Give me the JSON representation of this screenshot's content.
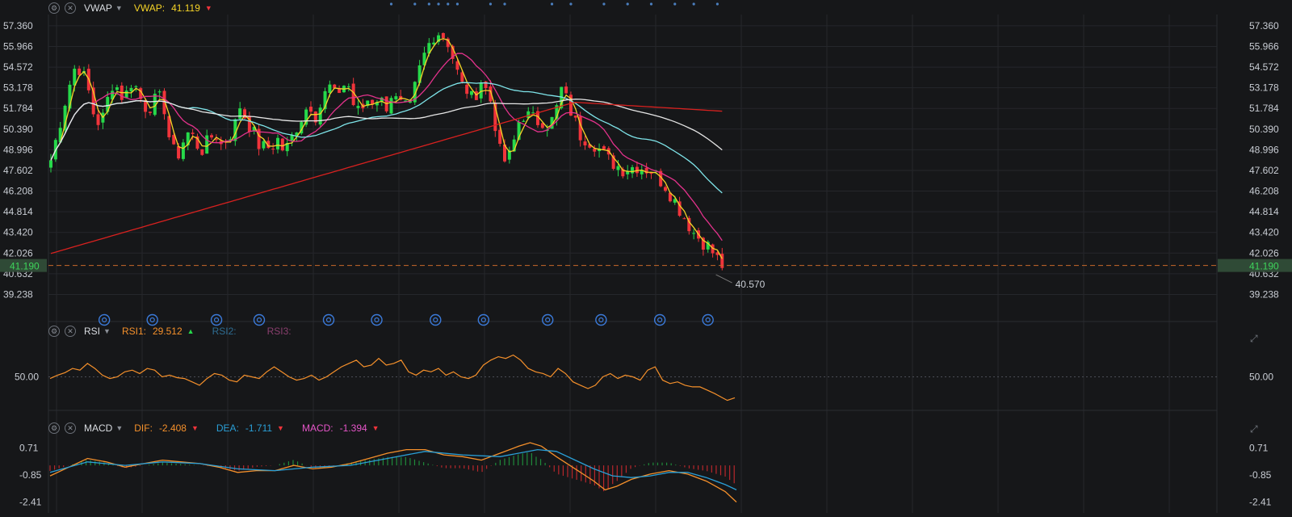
{
  "colors": {
    "background": "#161719",
    "grid": "#25272b",
    "axis_text": "#c9cdd4",
    "bull": "#26d94a",
    "bear": "#f0343b",
    "ma_yellow": "#f5d327",
    "ma_magenta": "#e3328c",
    "ma_cyan": "#7fe5ea",
    "ma_white": "#e6e6e6",
    "ma_red": "#d8211f",
    "rsi": "#f5902b",
    "dif": "#f5902b",
    "dea": "#2a9fd6",
    "price_line": "#c8692a",
    "last_price_bg": "#2f4a36",
    "last_price_text": "#3ed45b"
  },
  "main_pane": {
    "indicator_name": "VWAP",
    "indicator_label": "VWAP:",
    "indicator_value": "41.119",
    "indicator_value_color": "#f5d327",
    "settings_icon": "gear-icon",
    "close_icon": "close-icon"
  },
  "rsi_pane": {
    "indicator_name": "RSI",
    "rsi1_label": "RSI1:",
    "rsi1_value": "29.512",
    "rsi2_label": "RSI2:",
    "rsi3_label": "RSI3:"
  },
  "macd_pane": {
    "indicator_name": "MACD",
    "dif_label": "DIF:",
    "dif_value": "-2.408",
    "dea_label": "DEA:",
    "dea_value": "-1.711",
    "macd_label": "MACD:",
    "macd_value": "-1.394"
  },
  "chart_data": [
    {
      "type": "candlestick",
      "title": "",
      "y_ticks": [
        "57.360",
        "55.966",
        "54.572",
        "53.178",
        "51.784",
        "50.390",
        "48.996",
        "47.602",
        "46.208",
        "44.814",
        "43.420",
        "42.026",
        "40.632",
        "39.238"
      ],
      "ylim": [
        38.5,
        57.9
      ],
      "last_price": "41.190",
      "last_price_value": 41.19,
      "low_annotation": "40.570",
      "low_value": 40.57,
      "x_range": [
        0,
        245
      ],
      "last_index": 142,
      "low_index": 140,
      "close_anchors": [
        [
          0,
          48.3
        ],
        [
          4,
          50.6
        ],
        [
          8,
          53.0
        ],
        [
          12,
          54.8
        ],
        [
          15,
          54.2
        ],
        [
          18,
          52.9
        ],
        [
          21,
          51.0
        ],
        [
          24,
          50.8
        ],
        [
          27,
          52.4
        ],
        [
          30,
          53.8
        ],
        [
          33,
          52.6
        ],
        [
          36,
          52.8
        ],
        [
          39,
          53.8
        ],
        [
          42,
          52.6
        ],
        [
          45,
          51.9
        ],
        [
          48,
          52.0
        ],
        [
          51,
          52.6
        ],
        [
          54,
          51.8
        ],
        [
          57,
          49.2
        ],
        [
          60,
          48.5
        ],
        [
          63,
          49.6
        ],
        [
          66,
          50.3
        ],
        [
          69,
          49.4
        ],
        [
          72,
          49.0
        ],
        [
          75,
          49.6
        ],
        [
          78,
          50.2
        ],
        [
          81,
          49.3
        ],
        [
          84,
          49.8
        ],
        [
          87,
          50.4
        ],
        [
          90,
          52.0
        ],
        [
          93,
          51.0
        ],
        [
          96,
          50.3
        ],
        [
          99,
          49.3
        ],
        [
          102,
          49.1
        ],
        [
          105,
          49.2
        ],
        [
          108,
          49.7
        ],
        [
          111,
          48.8
        ],
        [
          114,
          49.6
        ],
        [
          117,
          50.6
        ],
        [
          120,
          51.4
        ],
        [
          123,
          52.2
        ],
        [
          126,
          51.3
        ],
        [
          129,
          52.2
        ],
        [
          132,
          53.4
        ],
        [
          135,
          52.6
        ],
        [
          138,
          53.2
        ],
        [
          141,
          53.6
        ],
        [
          144,
          52.0
        ],
        [
          147,
          51.4
        ],
        [
          150,
          52.4
        ],
        [
          153,
          52.3
        ],
        [
          156,
          52.6
        ],
        [
          159,
          51.8
        ],
        [
          162,
          52.8
        ],
        [
          165,
          52.1
        ],
        [
          168,
          51.8
        ],
        [
          171,
          51.8
        ],
        [
          174,
          53.8
        ],
        [
          177,
          55.2
        ],
        [
          180,
          56.2
        ],
        [
          183,
          57.0
        ],
        [
          186,
          56.8
        ],
        [
          189,
          56.2
        ],
        [
          192,
          54.8
        ],
        [
          195,
          53.4
        ],
        [
          198,
          53.0
        ],
        [
          201,
          52.2
        ],
        [
          204,
          53.8
        ],
        [
          207,
          53.0
        ],
        [
          210,
          52.0
        ],
        [
          213,
          49.0
        ],
        [
          216,
          48.2
        ],
        [
          219,
          48.7
        ],
        [
          222,
          50.8
        ],
        [
          225,
          51.4
        ],
        [
          228,
          51.2
        ],
        [
          231,
          50.9
        ],
        [
          234,
          51.0
        ],
        [
          237,
          50.6
        ],
        [
          240,
          51.5
        ],
        [
          243,
          53.2
        ],
        [
          245,
          52.4
        ]
      ],
      "close_anchors_tail": [
        [
          0,
          52.4
        ],
        [
          3,
          50.0
        ],
        [
          6,
          49.4
        ],
        [
          9,
          48.3
        ],
        [
          12,
          47.7
        ],
        [
          15,
          47.9
        ],
        [
          18,
          47.6
        ],
        [
          21,
          46.6
        ],
        [
          24,
          45.0
        ],
        [
          27,
          43.4
        ],
        [
          30,
          42.5
        ],
        [
          33,
          41.2
        ]
      ],
      "tail_start_index": 109,
      "ma_note": "",
      "series": [
        {
          "color_key": "ma_yellow",
          "period": 3
        },
        {
          "color_key": "ma_magenta",
          "period": 10
        },
        {
          "color_key": "ma_cyan",
          "period": 30
        },
        {
          "color_key": "ma_white",
          "period": 60
        },
        {
          "color_key": "ma_red",
          "period": 160
        }
      ],
      "event_marker_indices": [
        10,
        19,
        31,
        39,
        52,
        61,
        72,
        81,
        93,
        103,
        114,
        123
      ],
      "top_dot_indices": [
        72,
        77,
        80,
        82,
        84,
        86,
        93,
        96,
        106,
        110,
        117,
        122,
        127,
        132,
        136,
        141
      ]
    },
    {
      "type": "line",
      "title": "",
      "y_tick": "50.00",
      "ylim": [
        10,
        90
      ],
      "reference_value": 50,
      "series": [
        {
          "color_key": "rsi",
          "points": [
            [
              0,
              48
            ],
            [
              3,
              52
            ],
            [
              6,
              55
            ],
            [
              9,
              60
            ],
            [
              12,
              58
            ],
            [
              15,
              66
            ],
            [
              18,
              60
            ],
            [
              21,
              52
            ],
            [
              24,
              48
            ],
            [
              27,
              50
            ],
            [
              30,
              56
            ],
            [
              33,
              58
            ],
            [
              36,
              54
            ],
            [
              39,
              60
            ],
            [
              42,
              58
            ],
            [
              45,
              50
            ],
            [
              48,
              52
            ],
            [
              51,
              49
            ],
            [
              54,
              48
            ],
            [
              57,
              44
            ],
            [
              60,
              40
            ],
            [
              63,
              48
            ],
            [
              66,
              54
            ],
            [
              69,
              52
            ],
            [
              72,
              46
            ],
            [
              75,
              44
            ],
            [
              78,
              52
            ],
            [
              81,
              50
            ],
            [
              84,
              48
            ],
            [
              87,
              56
            ],
            [
              90,
              62
            ],
            [
              93,
              56
            ],
            [
              96,
              50
            ],
            [
              99,
              46
            ],
            [
              102,
              48
            ],
            [
              105,
              52
            ],
            [
              108,
              46
            ],
            [
              111,
              50
            ],
            [
              114,
              56
            ],
            [
              117,
              62
            ],
            [
              120,
              66
            ],
            [
              123,
              70
            ],
            [
              126,
              62
            ],
            [
              129,
              64
            ],
            [
              132,
              72
            ],
            [
              135,
              64
            ],
            [
              138,
              66
            ],
            [
              141,
              70
            ],
            [
              144,
              56
            ],
            [
              147,
              52
            ],
            [
              150,
              58
            ],
            [
              153,
              56
            ],
            [
              156,
              60
            ],
            [
              159,
              52
            ],
            [
              162,
              56
            ],
            [
              165,
              50
            ],
            [
              168,
              48
            ],
            [
              171,
              52
            ],
            [
              174,
              64
            ],
            [
              177,
              70
            ],
            [
              180,
              74
            ],
            [
              183,
              72
            ],
            [
              186,
              76
            ],
            [
              189,
              70
            ],
            [
              192,
              60
            ],
            [
              195,
              56
            ],
            [
              198,
              54
            ],
            [
              201,
              50
            ],
            [
              204,
              60
            ],
            [
              207,
              54
            ],
            [
              210,
              44
            ],
            [
              213,
              40
            ],
            [
              216,
              36
            ],
            [
              219,
              40
            ],
            [
              222,
              50
            ],
            [
              225,
              54
            ],
            [
              228,
              48
            ],
            [
              231,
              52
            ],
            [
              234,
              50
            ],
            [
              237,
              46
            ],
            [
              240,
              58
            ],
            [
              243,
              62
            ],
            [
              246,
              46
            ],
            [
              249,
              42
            ],
            [
              252,
              44
            ],
            [
              255,
              40
            ],
            [
              258,
              38
            ],
            [
              261,
              38
            ],
            [
              264,
              34
            ],
            [
              267,
              30
            ],
            [
              270,
              25
            ],
            [
              272,
              22
            ],
            [
              275,
              25
            ]
          ]
        }
      ]
    },
    {
      "type": "line",
      "title": "",
      "y_ticks": [
        "0.71",
        "-0.85",
        "-2.41"
      ],
      "ylim": [
        -2.7,
        1.0
      ],
      "series": [
        {
          "name": "DIF",
          "color_key": "dif",
          "points": [
            [
              0,
              -0.9
            ],
            [
              10,
              -0.4
            ],
            [
              20,
              0.1
            ],
            [
              30,
              -0.1
            ],
            [
              40,
              -0.4
            ],
            [
              50,
              -0.2
            ],
            [
              60,
              0.0
            ],
            [
              70,
              -0.1
            ],
            [
              80,
              -0.2
            ],
            [
              90,
              -0.4
            ],
            [
              100,
              -0.7
            ],
            [
              110,
              -0.6
            ],
            [
              120,
              -0.6
            ],
            [
              130,
              -0.3
            ],
            [
              140,
              -0.5
            ],
            [
              150,
              -0.4
            ],
            [
              160,
              -0.2
            ],
            [
              170,
              0.1
            ],
            [
              180,
              0.4
            ],
            [
              190,
              0.6
            ],
            [
              200,
              0.6
            ],
            [
              210,
              0.3
            ],
            [
              220,
              0.2
            ],
            [
              230,
              0.0
            ],
            [
              240,
              0.4
            ],
            [
              250,
              0.8
            ],
            [
              256,
              1.0
            ],
            [
              262,
              0.8
            ],
            [
              270,
              0.2
            ],
            [
              280,
              -0.5
            ],
            [
              290,
              -1.2
            ],
            [
              296,
              -1.7
            ],
            [
              302,
              -1.5
            ],
            [
              310,
              -1.1
            ],
            [
              320,
              -0.8
            ],
            [
              330,
              -0.6
            ],
            [
              340,
              -0.8
            ],
            [
              350,
              -1.2
            ],
            [
              360,
              -1.8
            ],
            [
              366,
              -2.4
            ]
          ]
        },
        {
          "name": "DEA",
          "color_key": "dea",
          "points": [
            [
              0,
              -0.7
            ],
            [
              20,
              -0.1
            ],
            [
              40,
              -0.3
            ],
            [
              60,
              -0.1
            ],
            [
              80,
              -0.2
            ],
            [
              100,
              -0.5
            ],
            [
              120,
              -0.6
            ],
            [
              140,
              -0.4
            ],
            [
              160,
              -0.3
            ],
            [
              180,
              0.1
            ],
            [
              200,
              0.5
            ],
            [
              220,
              0.3
            ],
            [
              240,
              0.2
            ],
            [
              260,
              0.6
            ],
            [
              270,
              0.5
            ],
            [
              280,
              0.0
            ],
            [
              290,
              -0.5
            ],
            [
              300,
              -0.9
            ],
            [
              310,
              -1.0
            ],
            [
              320,
              -0.9
            ],
            [
              330,
              -0.7
            ],
            [
              340,
              -0.7
            ],
            [
              350,
              -1.0
            ],
            [
              360,
              -1.4
            ],
            [
              366,
              -1.7
            ]
          ]
        }
      ]
    }
  ]
}
